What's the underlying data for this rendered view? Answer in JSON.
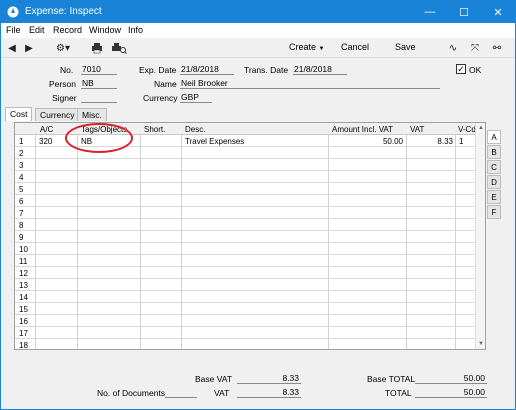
{
  "window": {
    "title": "Expense: Inspect",
    "minimize": "—",
    "maximize": "☐",
    "close": "✕"
  },
  "menu": [
    "File",
    "Edit",
    "Record",
    "Window",
    "Info"
  ],
  "toolbar": {
    "create": "Create",
    "cancel": "Cancel",
    "save": "Save",
    "icons": [
      "prev-record-icon",
      "next-record-icon",
      "gear-icon",
      "print-icon",
      "print-preview-icon",
      "sign-icon",
      "fullscreen-icon",
      "link-icon"
    ]
  },
  "header": {
    "no_label": "No.",
    "no": "7010",
    "exp_date_label": "Exp. Date",
    "exp_date": "21/8/2018",
    "trans_date_label": "Trans. Date",
    "trans_date": "21/8/2018",
    "ok_label": "OK",
    "ok_checked": true,
    "person_label": "Person",
    "person": "NB",
    "name_label": "Name",
    "name": "Neil Brooker",
    "signer_label": "Signer",
    "signer": "",
    "currency_label": "Currency",
    "currency": "GBP"
  },
  "tabs": [
    "Cost",
    "Currency",
    "Misc."
  ],
  "grid": {
    "columns": [
      "A/C",
      "Tags/Objects",
      "Short.",
      "Desc.",
      "Amount Incl. VAT",
      "VAT",
      "V-Cd"
    ],
    "rows": [
      {
        "n": "1",
        "ac": "320",
        "tags": "NB",
        "short": "",
        "desc": "Travel Expenses",
        "amount": "50.00",
        "vat": "8.33",
        "vcd": "1"
      },
      {
        "n": "2"
      },
      {
        "n": "3"
      },
      {
        "n": "4"
      },
      {
        "n": "5"
      },
      {
        "n": "6"
      },
      {
        "n": "7"
      },
      {
        "n": "8"
      },
      {
        "n": "9"
      },
      {
        "n": "10"
      },
      {
        "n": "11"
      },
      {
        "n": "12"
      },
      {
        "n": "13"
      },
      {
        "n": "14"
      },
      {
        "n": "15"
      },
      {
        "n": "16"
      },
      {
        "n": "17"
      },
      {
        "n": "18"
      }
    ]
  },
  "side_tabs": [
    "A",
    "B",
    "C",
    "D",
    "E",
    "F"
  ],
  "footer": {
    "base_vat_label": "Base VAT",
    "base_vat": "8.33",
    "base_total_label": "Base TOTAL",
    "base_total": "50.00",
    "no_docs_label": "No. of Documents",
    "no_docs": "",
    "vat_label": "VAT",
    "vat": "8.33",
    "total_label": "TOTAL",
    "total": "50.00"
  },
  "colors": {
    "titlebar": "#1883d7",
    "highlight": "#d8212a"
  }
}
